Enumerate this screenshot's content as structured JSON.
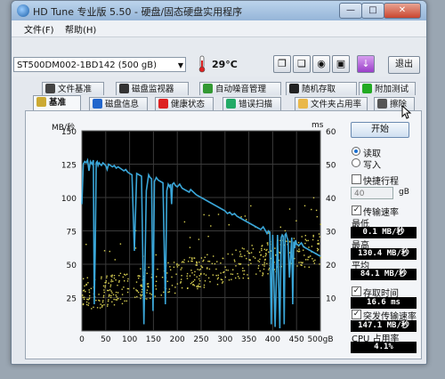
{
  "window": {
    "title": "HD Tune 专业版 5.50 - 硬盘/固态硬盘实用程序",
    "min_label": "—",
    "max_label": "□",
    "close_label": "✕"
  },
  "menu": {
    "file": "文件(F)",
    "help": "帮助(H)"
  },
  "toolbar": {
    "drive": "ST500DM002-1BD142 (500 gB)",
    "temperature": "29°C",
    "exit_label": "退出"
  },
  "tabs_row1": [
    "文件基准",
    "磁盘监视器",
    "自动噪音管理",
    "随机存取",
    "附加测试"
  ],
  "tabs_row2": [
    "基准",
    "磁盘信息",
    "健康状态",
    "错误扫描",
    "文件夹占用率",
    "擦除"
  ],
  "active_tab": "基准",
  "controls": {
    "start_label": "开始",
    "read_label": "读取",
    "write_label": "写入",
    "read_selected": true,
    "quick_label": "快捷行程",
    "quick_checked": false,
    "quick_value": "40",
    "quick_unit": "gB",
    "transfer_label": "传输速率",
    "transfer_checked": true,
    "min_label": "最低",
    "min_value": "0.1 MB/秒",
    "max_label": "最高",
    "max_value": "130.4 MB/秒",
    "avg_label": "平均",
    "avg_value": "84.1 MB/秒",
    "access_label": "存取时间",
    "access_checked": true,
    "access_value": "16.6 ms",
    "burst_label": "突发传输速率",
    "burst_checked": true,
    "burst_value": "147.1 MB/秒",
    "cpu_label": "CPU 占用率",
    "cpu_value": "4.1%"
  },
  "chart_data": {
    "type": "line",
    "left_unit": "MB/秒",
    "right_unit": "ms",
    "y_ticks_left": [
      "150",
      "125",
      "100",
      "75",
      "50",
      "25"
    ],
    "y_ticks_right": [
      "60",
      "50",
      "40",
      "30",
      "20",
      "10"
    ],
    "x_ticks": [
      "0",
      "50",
      "100",
      "150",
      "200",
      "250",
      "300",
      "350",
      "400",
      "450",
      "500gB"
    ],
    "xlim": [
      0,
      500
    ],
    "ylim_left": [
      0,
      150
    ],
    "ylim_right": [
      0,
      60
    ],
    "series": [
      {
        "color": "#3aa6d8",
        "x": [
          0,
          3,
          6,
          9,
          12,
          15,
          18,
          21,
          24,
          26,
          28,
          30,
          32,
          34,
          36,
          38,
          41,
          44,
          47,
          50,
          53,
          56,
          60,
          64,
          68,
          72,
          76,
          80,
          84,
          88,
          92,
          96,
          100,
          105,
          110,
          115,
          120,
          125,
          130,
          135,
          140,
          143,
          146,
          149,
          152,
          156,
          160,
          165,
          170,
          175,
          178,
          181,
          184,
          186,
          188,
          190,
          193,
          196,
          200,
          205,
          210,
          215,
          220,
          225,
          228,
          231,
          234,
          237,
          240,
          245,
          250,
          255,
          260,
          265,
          270,
          275,
          280,
          285,
          290,
          295,
          300,
          305,
          310,
          315,
          320,
          325,
          330,
          335,
          340,
          345,
          350,
          355,
          360,
          365,
          370,
          375,
          380,
          385,
          388,
          391,
          394,
          397,
          400,
          405,
          410,
          415,
          418,
          420,
          422,
          424,
          426,
          428,
          430,
          432,
          435,
          440,
          442,
          444,
          446,
          448,
          450,
          455,
          460,
          465,
          470,
          475,
          480,
          485,
          490,
          495,
          500
        ],
        "y": [
          95,
          125,
          127,
          126,
          128,
          120,
          127,
          125,
          128,
          20,
          60,
          126,
          127,
          124,
          126,
          125,
          124,
          126,
          125,
          124,
          121,
          125,
          124,
          123,
          124,
          122,
          123,
          122,
          121,
          120,
          121,
          119,
          118,
          117,
          60,
          118,
          117,
          116,
          5,
          105,
          117,
          115,
          114,
          15,
          112,
          115,
          113,
          112,
          111,
          20,
          105,
          110,
          108,
          110,
          95,
          110,
          111,
          109,
          108,
          110,
          107,
          106,
          105,
          104,
          106,
          105,
          104,
          103,
          102,
          101,
          100,
          99,
          98,
          97,
          96,
          95,
          94,
          93,
          92,
          91,
          90,
          88,
          89,
          87,
          88,
          86,
          85,
          84,
          83,
          82,
          81,
          80,
          79,
          78,
          77,
          76,
          78,
          75,
          73,
          75,
          74,
          5,
          72,
          3,
          72,
          2,
          70,
          72,
          71,
          5,
          72,
          73,
          70,
          68,
          40,
          70,
          20,
          67,
          62,
          68,
          65,
          64,
          66,
          63,
          62,
          61,
          60,
          59,
          58,
          57,
          56
        ],
        "axis": "left"
      },
      {
        "color": "#d8cf52",
        "kind": "scatter",
        "axis": "right",
        "x_range": [
          0,
          500
        ],
        "y_range_approx": [
          6,
          32
        ]
      }
    ]
  }
}
